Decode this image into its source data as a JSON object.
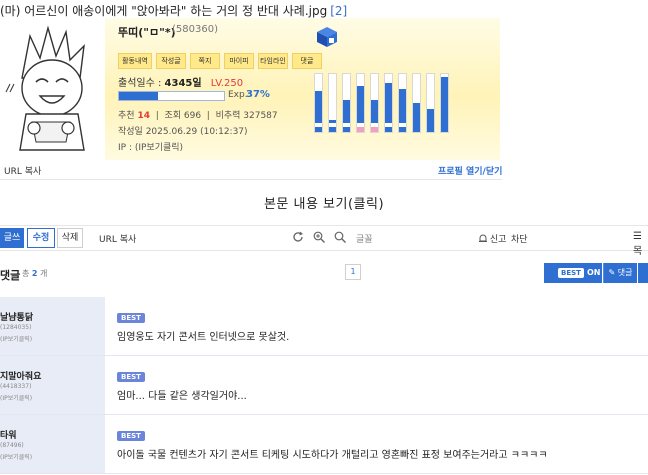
{
  "post": {
    "title": "(마) 어르신이 애송이에게 \"앉아봐라\" 하는 거의 정 반대 사례.jpg",
    "comment_count": "[2]"
  },
  "profile": {
    "nickname": "뚜띠(\"ㅁ\"*)",
    "user_id": "(580360)",
    "menu": [
      "활동내역",
      "작성글",
      "쪽지",
      "마이피",
      "타임라인",
      "댓글"
    ],
    "attendance_label": "출석일수 :",
    "attendance_value": "4345일",
    "level": "LV.250",
    "exp_label": "Exp.",
    "exp_percent": "37%",
    "exp_fraction": 0.37,
    "recommend_label": "추천",
    "recommend_value": "14",
    "views_label": "조회",
    "views_value": "696",
    "ratio_label": "비추력",
    "ratio_value": "327587",
    "written_at": "작성일 2025.06.29 (10:12:37)",
    "ip": "IP : (IP보기클릭)",
    "url_copy": "URL 복사",
    "toggle": "프로필 열기/닫기",
    "bars": [
      {
        "fill": 0.7,
        "stripe": "blue"
      },
      {
        "fill": 0.2,
        "stripe": "blue"
      },
      {
        "fill": 0.55,
        "stripe": "blue"
      },
      {
        "fill": 0.8,
        "stripe": "pink"
      },
      {
        "fill": 0.55,
        "stripe": "pink"
      },
      {
        "fill": 0.85,
        "stripe": "blue"
      },
      {
        "fill": 0.75,
        "stripe": "blue"
      },
      {
        "fill": 0.5,
        "stripe": "none"
      },
      {
        "fill": 0.4,
        "stripe": "none"
      },
      {
        "fill": 0.95,
        "stripe": "none"
      }
    ],
    "colors": {
      "accent": "#2f6fd1",
      "pink": "#f2a0c0",
      "card_bg": "#fff3b8"
    }
  },
  "view_body": "본문 내용 보기(클릭)",
  "toolbar": {
    "write": "글쓰기",
    "edit": "수정",
    "delete": "삭제",
    "url_copy": "URL 복사",
    "search_placeholder": "글꼴",
    "report": "신고",
    "block": "차단",
    "list": "목"
  },
  "comments_header": {
    "title": "댓글",
    "total_prefix": "총",
    "total": "2",
    "total_suffix": "개",
    "page": "1",
    "best_on_pill": "BEST",
    "best_on_state": "ON",
    "write_comment": "댓글"
  },
  "comments": [
    {
      "nickname": "날냠통닭",
      "meta1": "(1284035)",
      "meta2": "(IP보기클릭)",
      "badge": "BEST",
      "text": "임영웅도 자기 콘서트 인터넷으로 못살것."
    },
    {
      "nickname": "지말아줘요",
      "meta1": "(4418337)",
      "meta2": "(IP보기클릭)",
      "badge": "BEST",
      "text": "엄마... 다들 같은 생각일거야..."
    },
    {
      "nickname": "타워",
      "meta1": "(87496)",
      "meta2": "(IP보기클릭)",
      "badge": "BEST",
      "text": "아이돌 국물 컨텐츠가 자기 콘서트 티케팅 시도하다가 개털리고 영혼빠진 표정 보여주는거라고 ㅋㅋㅋㅋ"
    }
  ]
}
